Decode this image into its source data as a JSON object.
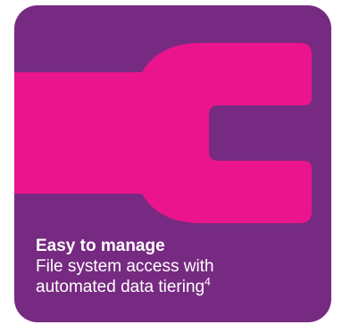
{
  "card": {
    "background_color": "#772a81",
    "icon": "wrench-icon",
    "icon_color": "#ea158c",
    "title": "Easy to manage",
    "description_line1": "File system access with",
    "description_line2": "automated data tiering",
    "footnote_marker": "4"
  }
}
